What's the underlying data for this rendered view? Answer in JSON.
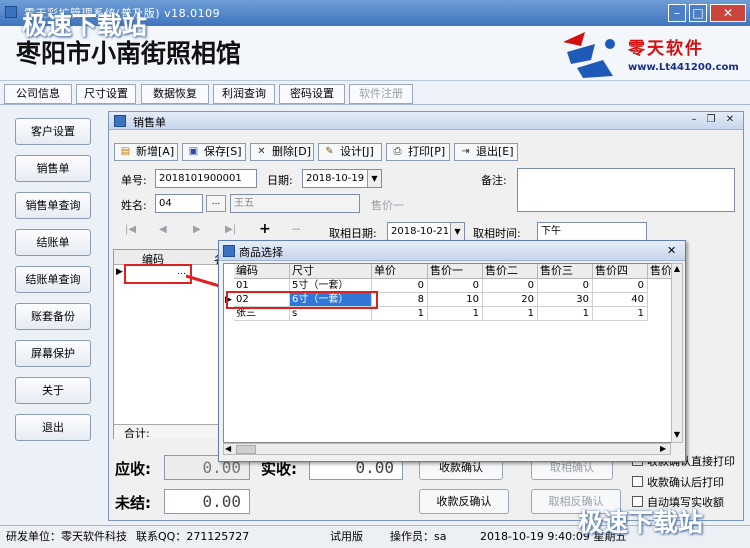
{
  "window": {
    "title": "零天彩扩管理系统(普及版) v18.0109",
    "min": "–",
    "max": "□",
    "close": "✕"
  },
  "header": {
    "shop_name": "枣阳市小南街照相馆",
    "logo_text": "零天软件",
    "logo_url": "www.Lt441200.com"
  },
  "watermark": "极速下载站",
  "top_nav": [
    "公司信息",
    "尺寸设置",
    "数据恢复",
    "利润查询",
    "密码设置",
    "软件注册"
  ],
  "side_nav": [
    "客户设置",
    "销售单",
    "销售单查询",
    "结账单",
    "结账单查询",
    "账套备份",
    "屏幕保护",
    "关于",
    "退出"
  ],
  "sales_window": {
    "title": "销售单",
    "toolbar": [
      "新增[A]",
      "保存[S]",
      "删除[D]",
      "设计[J]",
      "打印[P]",
      "退出[E]"
    ],
    "order_no_label": "单号:",
    "order_no": "2018101900001",
    "date_label": "日期:",
    "date": "2018-10-19",
    "remark_label": "备注:",
    "name_label": "姓名:",
    "customer_code": "04",
    "lookup_btn": "...",
    "customer_name": "王五",
    "price_level": "售价一",
    "pickup_date_label": "取相日期:",
    "pickup_date": "2018-10-21",
    "pickup_time_label": "取相时间:",
    "pickup_time": "下午",
    "nav_glyphs": [
      "|◀",
      "◀",
      "▶",
      "▶|",
      "+",
      "−"
    ],
    "grid_col_code": "编码",
    "grid_col_trunc": "名",
    "grid_cell_btn": "...",
    "total_label": "合计:",
    "receivable_label": "应收:",
    "receivable": "0.00",
    "received_label": "实收:",
    "received": "0.00",
    "outstanding_label": "未结:",
    "outstanding": "0.00",
    "btn_confirm": "收款确认",
    "btn_unconfirm": "收款反确认",
    "btn_pickup_confirm": "取相确认",
    "btn_pickup_unconfirm": "取相反确认",
    "chk_print": "收款确认直接打印",
    "chk_print_after": "收款确认后打印",
    "chk_autofill": "自动填写实收额"
  },
  "popup": {
    "title": "商品选择",
    "columns": [
      "编码",
      "尺寸",
      "单价",
      "售价一",
      "售价二",
      "售价三",
      "售价四",
      "售价"
    ],
    "rows": [
      [
        "01",
        "5寸（一套）",
        "0",
        "0",
        "0",
        "0",
        "0"
      ],
      [
        "02",
        "6寸（一套）",
        "8",
        "10",
        "20",
        "30",
        "40"
      ],
      [
        "张三",
        "s",
        "1",
        "1",
        "1",
        "1",
        "1"
      ]
    ],
    "close": "✕"
  },
  "status_bar": {
    "developer": "研发单位：零天软件科技",
    "qq": "联系QQ：271125727",
    "edition": "试用版",
    "operator": "操作员：sa",
    "datetime": "2018-10-19  9:40:09  星期五"
  },
  "colors": {
    "title_bar": "#3f74bd",
    "selection": "#3178d6",
    "highlight_box": "#e02020",
    "logo_red": "#d21010"
  }
}
